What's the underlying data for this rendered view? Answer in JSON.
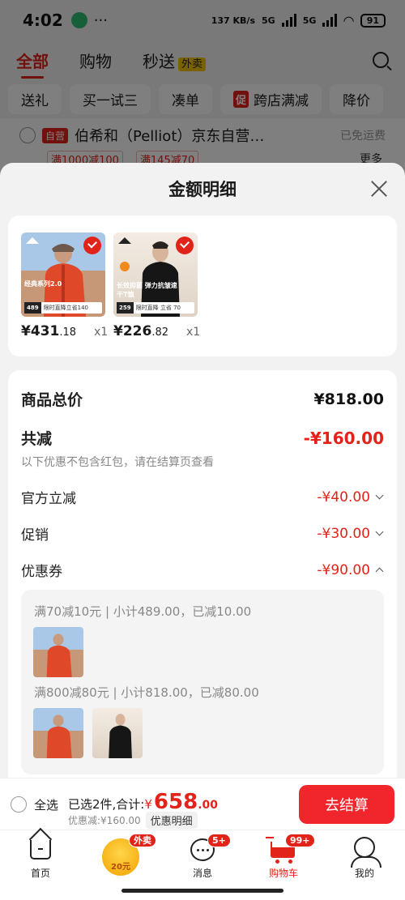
{
  "status_bar": {
    "time": "4:02",
    "dots": "···",
    "net_speed": "137 KB/s",
    "sig1": "5G",
    "sig2": "5G",
    "battery": "91"
  },
  "top_tabs": {
    "all": "全部",
    "shopping": "购物",
    "express": "秒送",
    "express_tag": "外卖"
  },
  "chips": [
    "送礼",
    "买一试三",
    "凑单",
    "跨店满减",
    "降价"
  ],
  "chip_cu": "促",
  "shop": {
    "ziying": "自营",
    "name": "伯希和（Pelliot）京东自营…",
    "free_shipping": "已免运费",
    "promo1": "满1000减100",
    "promo2": "满145减70",
    "more": "更多"
  },
  "sheet": {
    "title": "金额明细"
  },
  "products": [
    {
      "int": "431",
      "dec": ".18",
      "qty": "x1",
      "tag": "经典系列2.0",
      "price_tag": "489",
      "bar_text": "限时直降立省140"
    },
    {
      "int": "226",
      "dec": ".82",
      "qty": "x1",
      "tag": "长效抑菌 弹力抗皱速干T恤",
      "price_tag": "259",
      "bar_text": "限时直降 立省 70"
    }
  ],
  "currency": "¥",
  "details": {
    "total_label": "商品总价",
    "total_value": "¥818.00",
    "discount_label": "共减",
    "discount_value": "-¥160.00",
    "discount_note": "以下优惠不包含红包，请在结算页查看",
    "official_label": "官方立减",
    "official_value": "-¥40.00",
    "promo_label": "促销",
    "promo_value": "-¥30.00",
    "coupon_label": "优惠券",
    "coupon_value": "-¥90.00",
    "coupon_lines": [
      "满70减10元 | 小计489.00，已减10.00",
      "满800减80元 | 小计818.00，已减80.00"
    ]
  },
  "checkout": {
    "select_all": "全选",
    "summary": "已选2件,合计:",
    "currency": "¥",
    "amount": "658",
    "decimal": ".00",
    "discount_text": "优惠减:¥160.00",
    "detail_btn": "优惠明细",
    "go": "去结算"
  },
  "tabbar": {
    "home": "首页",
    "coin_badge": "外卖",
    "coin_label": "20元",
    "msg": "消息",
    "msg_badge": "5+",
    "cart": "购物车",
    "cart_badge": "99+",
    "me": "我的"
  },
  "colors": {
    "accent": "#e2231a",
    "button": "#f0262c"
  }
}
